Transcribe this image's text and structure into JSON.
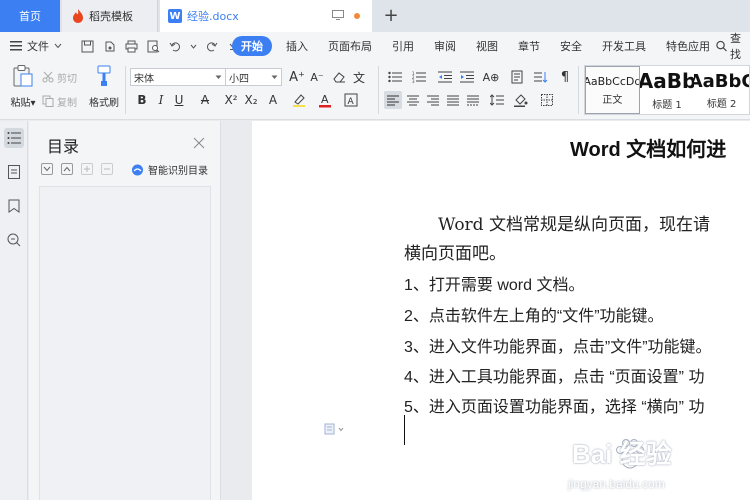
{
  "tabs": {
    "home": "首页",
    "template": "稻壳模板",
    "doc": "经验.docx",
    "add": "+"
  },
  "menu": {
    "file": "文件",
    "tabs": [
      "开始",
      "插入",
      "页面布局",
      "引用",
      "审阅",
      "视图",
      "章节",
      "安全",
      "开发工具",
      "特色应用"
    ],
    "active_tab": "开始",
    "search": "查找"
  },
  "ribbon": {
    "paste": "粘贴",
    "cut": "剪切",
    "copy": "复制",
    "format_painter": "格式刷",
    "font_name": "宋体",
    "font_size": "小四",
    "styles": [
      {
        "sample": "AaBbCcDd",
        "name": "正文"
      },
      {
        "sample": "AaBb",
        "name": "标题 1"
      },
      {
        "sample": "AaBbC",
        "name": "标题 2"
      }
    ]
  },
  "toc": {
    "title": "目录",
    "smart_toc": "智能识别目录"
  },
  "document": {
    "title": "Word 文档如何进",
    "intro_line1": "Word 文档常规是纵向页面，现在请",
    "intro_line2": "横向页面吧。",
    "steps": [
      "1、打开需要 word 文档。",
      "2、点击软件左上角的“文件”功能键。",
      "3、进入文件功能界面，点击”文件”功能键。",
      "4、进入工具功能界面，点击 “页面设置” 功",
      "5、进入页面设置功能界面，选择 “横向” 功"
    ]
  },
  "watermark": {
    "brand": "Bai 经验",
    "url": "jingyan.baidu.com"
  },
  "colors": {
    "accent": "#3c7ff3",
    "tab_bar": "#dfe3ea",
    "toolbar": "#f4f5f7",
    "page": "#ffffff"
  }
}
